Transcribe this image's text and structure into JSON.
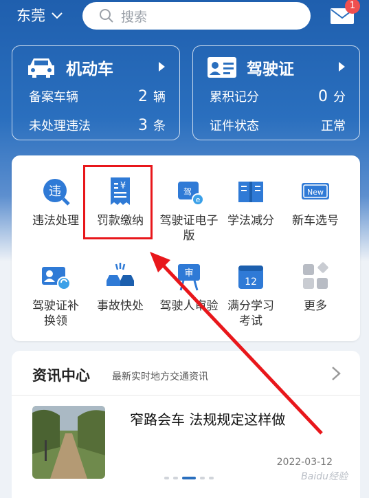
{
  "topbar": {
    "city": "东莞",
    "search_placeholder": "搜索",
    "mail_badge": "1"
  },
  "vehicle_card": {
    "title": "机动车",
    "rows": [
      {
        "label": "备案车辆",
        "value": "2",
        "unit": "辆"
      },
      {
        "label": "未处理违法",
        "value": "3",
        "unit": "条"
      }
    ]
  },
  "license_card": {
    "title": "驾驶证",
    "rows": [
      {
        "label": "累积记分",
        "value": "0",
        "unit": "分"
      },
      {
        "label": "证件状态",
        "value": "",
        "unit": "正常"
      }
    ]
  },
  "services": [
    {
      "label": "违法处理",
      "icon": "violation-icon"
    },
    {
      "label": "罚款缴纳",
      "icon": "fine-receipt-icon"
    },
    {
      "label": "驾驶证电子版",
      "icon": "e-license-icon"
    },
    {
      "label": "学法减分",
      "icon": "book-icon"
    },
    {
      "label": "新车选号",
      "icon": "new-plate-icon"
    },
    {
      "label": "驾驶证补换领",
      "icon": "license-renew-icon"
    },
    {
      "label": "事故快处",
      "icon": "accident-icon"
    },
    {
      "label": "驾驶人审验",
      "icon": "review-icon"
    },
    {
      "label": "满分学习考试",
      "icon": "calendar-12-icon"
    },
    {
      "label": "更多",
      "icon": "more-grid-icon"
    }
  ],
  "news": {
    "title": "资讯中心",
    "subtitle": "最新实时地方交通资讯",
    "headline": "窄路会车 法规规定这样做",
    "date": "2022-03-12",
    "watermark": "Baidu经验"
  },
  "colors": {
    "primary": "#2a6fbe",
    "highlight": "#e8171b",
    "badge": "#ef4f4f"
  }
}
